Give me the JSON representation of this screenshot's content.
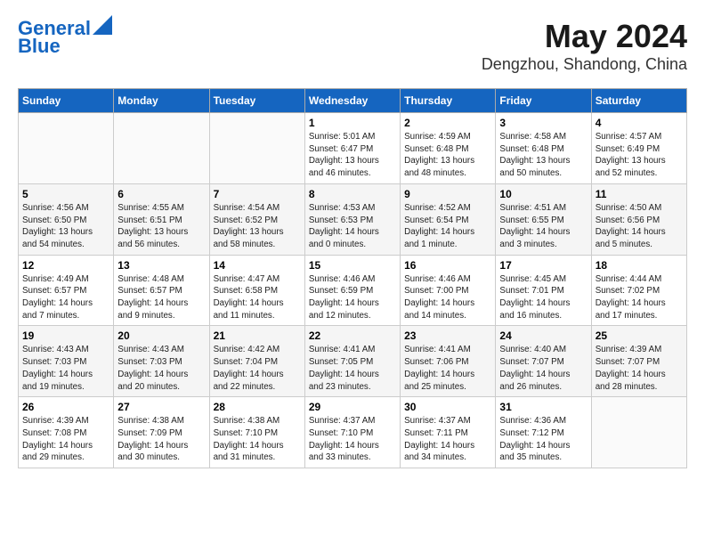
{
  "logo": {
    "line1": "General",
    "line2": "Blue"
  },
  "header": {
    "month": "May 2024",
    "location": "Dengzhou, Shandong, China"
  },
  "days_of_week": [
    "Sunday",
    "Monday",
    "Tuesday",
    "Wednesday",
    "Thursday",
    "Friday",
    "Saturday"
  ],
  "weeks": [
    [
      {
        "day": "",
        "info": ""
      },
      {
        "day": "",
        "info": ""
      },
      {
        "day": "",
        "info": ""
      },
      {
        "day": "1",
        "info": "Sunrise: 5:01 AM\nSunset: 6:47 PM\nDaylight: 13 hours\nand 46 minutes."
      },
      {
        "day": "2",
        "info": "Sunrise: 4:59 AM\nSunset: 6:48 PM\nDaylight: 13 hours\nand 48 minutes."
      },
      {
        "day": "3",
        "info": "Sunrise: 4:58 AM\nSunset: 6:48 PM\nDaylight: 13 hours\nand 50 minutes."
      },
      {
        "day": "4",
        "info": "Sunrise: 4:57 AM\nSunset: 6:49 PM\nDaylight: 13 hours\nand 52 minutes."
      }
    ],
    [
      {
        "day": "5",
        "info": "Sunrise: 4:56 AM\nSunset: 6:50 PM\nDaylight: 13 hours\nand 54 minutes."
      },
      {
        "day": "6",
        "info": "Sunrise: 4:55 AM\nSunset: 6:51 PM\nDaylight: 13 hours\nand 56 minutes."
      },
      {
        "day": "7",
        "info": "Sunrise: 4:54 AM\nSunset: 6:52 PM\nDaylight: 13 hours\nand 58 minutes."
      },
      {
        "day": "8",
        "info": "Sunrise: 4:53 AM\nSunset: 6:53 PM\nDaylight: 14 hours\nand 0 minutes."
      },
      {
        "day": "9",
        "info": "Sunrise: 4:52 AM\nSunset: 6:54 PM\nDaylight: 14 hours\nand 1 minute."
      },
      {
        "day": "10",
        "info": "Sunrise: 4:51 AM\nSunset: 6:55 PM\nDaylight: 14 hours\nand 3 minutes."
      },
      {
        "day": "11",
        "info": "Sunrise: 4:50 AM\nSunset: 6:56 PM\nDaylight: 14 hours\nand 5 minutes."
      }
    ],
    [
      {
        "day": "12",
        "info": "Sunrise: 4:49 AM\nSunset: 6:57 PM\nDaylight: 14 hours\nand 7 minutes."
      },
      {
        "day": "13",
        "info": "Sunrise: 4:48 AM\nSunset: 6:57 PM\nDaylight: 14 hours\nand 9 minutes."
      },
      {
        "day": "14",
        "info": "Sunrise: 4:47 AM\nSunset: 6:58 PM\nDaylight: 14 hours\nand 11 minutes."
      },
      {
        "day": "15",
        "info": "Sunrise: 4:46 AM\nSunset: 6:59 PM\nDaylight: 14 hours\nand 12 minutes."
      },
      {
        "day": "16",
        "info": "Sunrise: 4:46 AM\nSunset: 7:00 PM\nDaylight: 14 hours\nand 14 minutes."
      },
      {
        "day": "17",
        "info": "Sunrise: 4:45 AM\nSunset: 7:01 PM\nDaylight: 14 hours\nand 16 minutes."
      },
      {
        "day": "18",
        "info": "Sunrise: 4:44 AM\nSunset: 7:02 PM\nDaylight: 14 hours\nand 17 minutes."
      }
    ],
    [
      {
        "day": "19",
        "info": "Sunrise: 4:43 AM\nSunset: 7:03 PM\nDaylight: 14 hours\nand 19 minutes."
      },
      {
        "day": "20",
        "info": "Sunrise: 4:43 AM\nSunset: 7:03 PM\nDaylight: 14 hours\nand 20 minutes."
      },
      {
        "day": "21",
        "info": "Sunrise: 4:42 AM\nSunset: 7:04 PM\nDaylight: 14 hours\nand 22 minutes."
      },
      {
        "day": "22",
        "info": "Sunrise: 4:41 AM\nSunset: 7:05 PM\nDaylight: 14 hours\nand 23 minutes."
      },
      {
        "day": "23",
        "info": "Sunrise: 4:41 AM\nSunset: 7:06 PM\nDaylight: 14 hours\nand 25 minutes."
      },
      {
        "day": "24",
        "info": "Sunrise: 4:40 AM\nSunset: 7:07 PM\nDaylight: 14 hours\nand 26 minutes."
      },
      {
        "day": "25",
        "info": "Sunrise: 4:39 AM\nSunset: 7:07 PM\nDaylight: 14 hours\nand 28 minutes."
      }
    ],
    [
      {
        "day": "26",
        "info": "Sunrise: 4:39 AM\nSunset: 7:08 PM\nDaylight: 14 hours\nand 29 minutes."
      },
      {
        "day": "27",
        "info": "Sunrise: 4:38 AM\nSunset: 7:09 PM\nDaylight: 14 hours\nand 30 minutes."
      },
      {
        "day": "28",
        "info": "Sunrise: 4:38 AM\nSunset: 7:10 PM\nDaylight: 14 hours\nand 31 minutes."
      },
      {
        "day": "29",
        "info": "Sunrise: 4:37 AM\nSunset: 7:10 PM\nDaylight: 14 hours\nand 33 minutes."
      },
      {
        "day": "30",
        "info": "Sunrise: 4:37 AM\nSunset: 7:11 PM\nDaylight: 14 hours\nand 34 minutes."
      },
      {
        "day": "31",
        "info": "Sunrise: 4:36 AM\nSunset: 7:12 PM\nDaylight: 14 hours\nand 35 minutes."
      },
      {
        "day": "",
        "info": ""
      }
    ]
  ]
}
